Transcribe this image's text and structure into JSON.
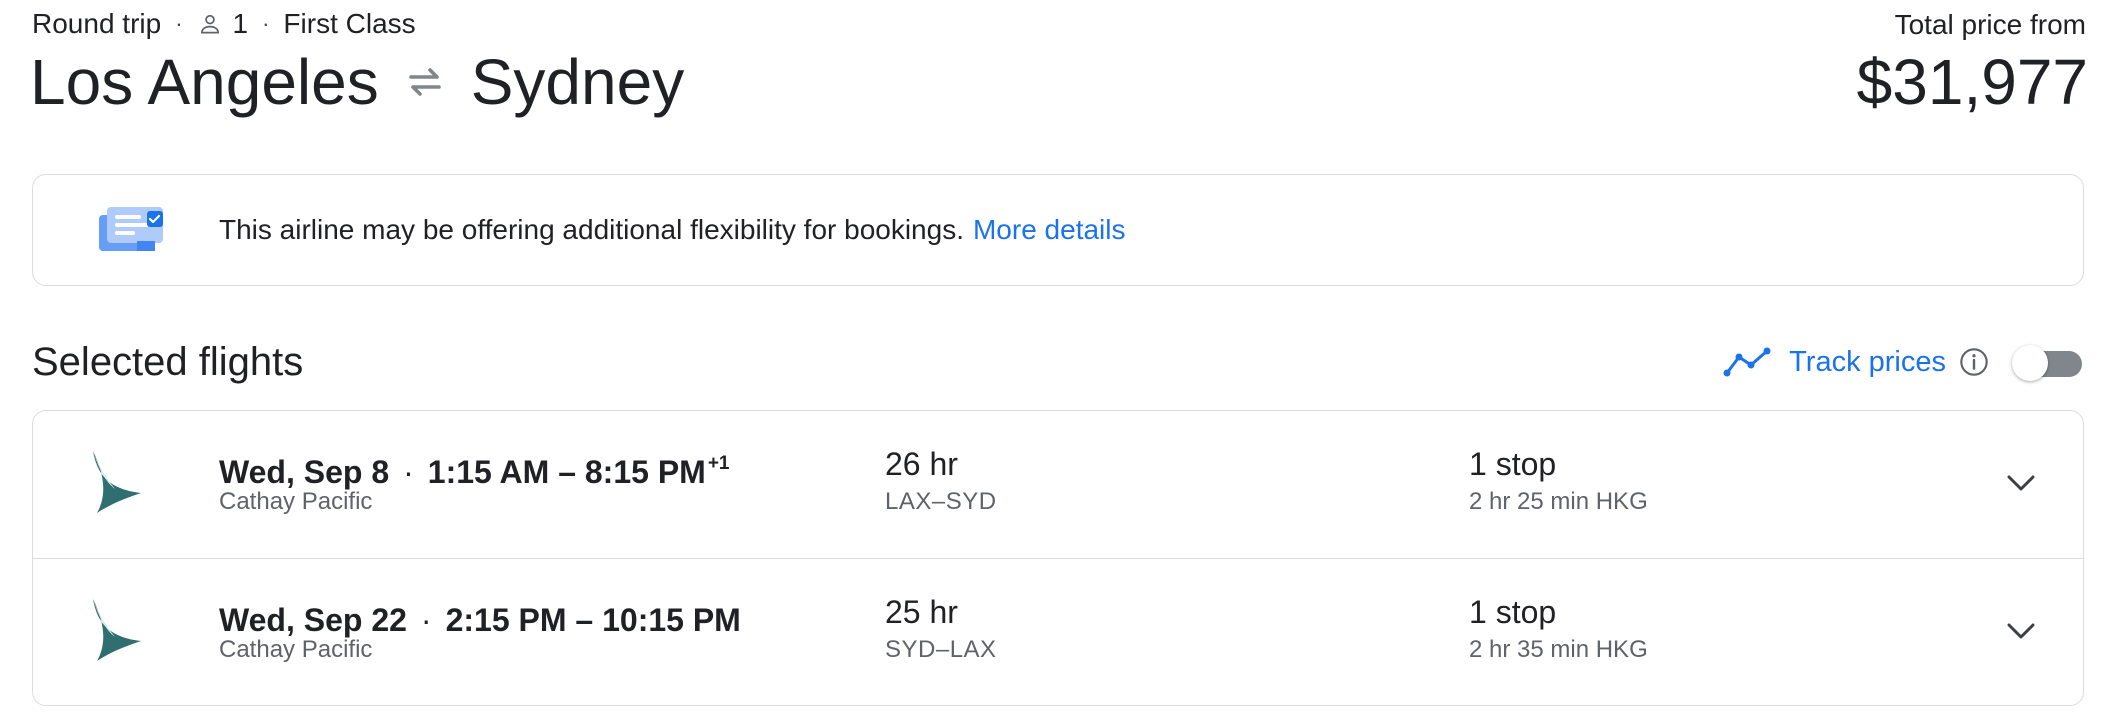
{
  "header": {
    "trip_type": "Round trip",
    "passengers": "1",
    "cabin": "First Class",
    "origin": "Los Angeles",
    "destination": "Sydney",
    "total_label": "Total price from",
    "total_price": "$31,977"
  },
  "banner": {
    "text": "This airline may be offering additional flexibility for bookings.",
    "link": "More details"
  },
  "section": {
    "title": "Selected flights",
    "track_label": "Track prices"
  },
  "flights": [
    {
      "date": "Wed, Sep 8",
      "times": "1:15 AM – 8:15 PM",
      "day_offset": "+1",
      "airline": "Cathay Pacific",
      "duration": "26 hr",
      "route": "LAX–SYD",
      "stops": "1 stop",
      "layover": "2 hr 25 min HKG"
    },
    {
      "date": "Wed, Sep 22",
      "times": "2:15 PM – 10:15 PM",
      "day_offset": "",
      "airline": "Cathay Pacific",
      "duration": "25 hr",
      "route": "SYD–LAX",
      "stops": "1 stop",
      "layover": "2 hr 35 min HKG"
    }
  ],
  "colors": {
    "link_blue": "#1a73e8",
    "border": "#dadce0",
    "secondary_text": "#5f6368",
    "cathay_teal": "#2f6f6f"
  }
}
